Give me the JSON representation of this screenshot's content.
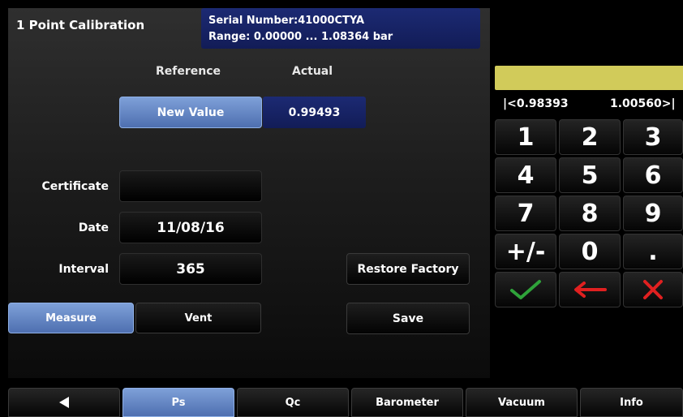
{
  "header": {
    "title": "1 Point Calibration",
    "serial_line": "Serial Number:41000CTYA",
    "range_line": "Range: 0.00000 ... 1.08364 bar"
  },
  "columns": {
    "reference": "Reference",
    "actual": "Actual"
  },
  "calibration": {
    "new_value_label": "New Value",
    "actual_value": "0.99493"
  },
  "fields": {
    "certificate_label": "Certificate",
    "certificate_value": "",
    "date_label": "Date",
    "date_value": "11/08/16",
    "interval_label": "Interval",
    "interval_value": "365"
  },
  "buttons": {
    "restore_factory": "Restore Factory",
    "measure": "Measure",
    "vent": "Vent",
    "save": "Save"
  },
  "keypad": {
    "display_value": "",
    "range_min": "|<0.98393",
    "range_max": "1.00560>|",
    "keys": [
      "1",
      "2",
      "3",
      "4",
      "5",
      "6",
      "7",
      "8",
      "9",
      "+/-",
      "0",
      "."
    ],
    "accept_icon": "checkmark-icon",
    "backspace_icon": "left-arrow-icon",
    "cancel_icon": "x-icon",
    "colors": {
      "accept": "#2fa33a",
      "backspace": "#e02020",
      "cancel": "#e02020",
      "display": "#d1cb5a"
    }
  },
  "tabs": {
    "back_icon": "left-triangle-icon",
    "items": [
      "Ps",
      "Qc",
      "Barometer",
      "Vacuum",
      "Info"
    ],
    "active": "Ps"
  }
}
